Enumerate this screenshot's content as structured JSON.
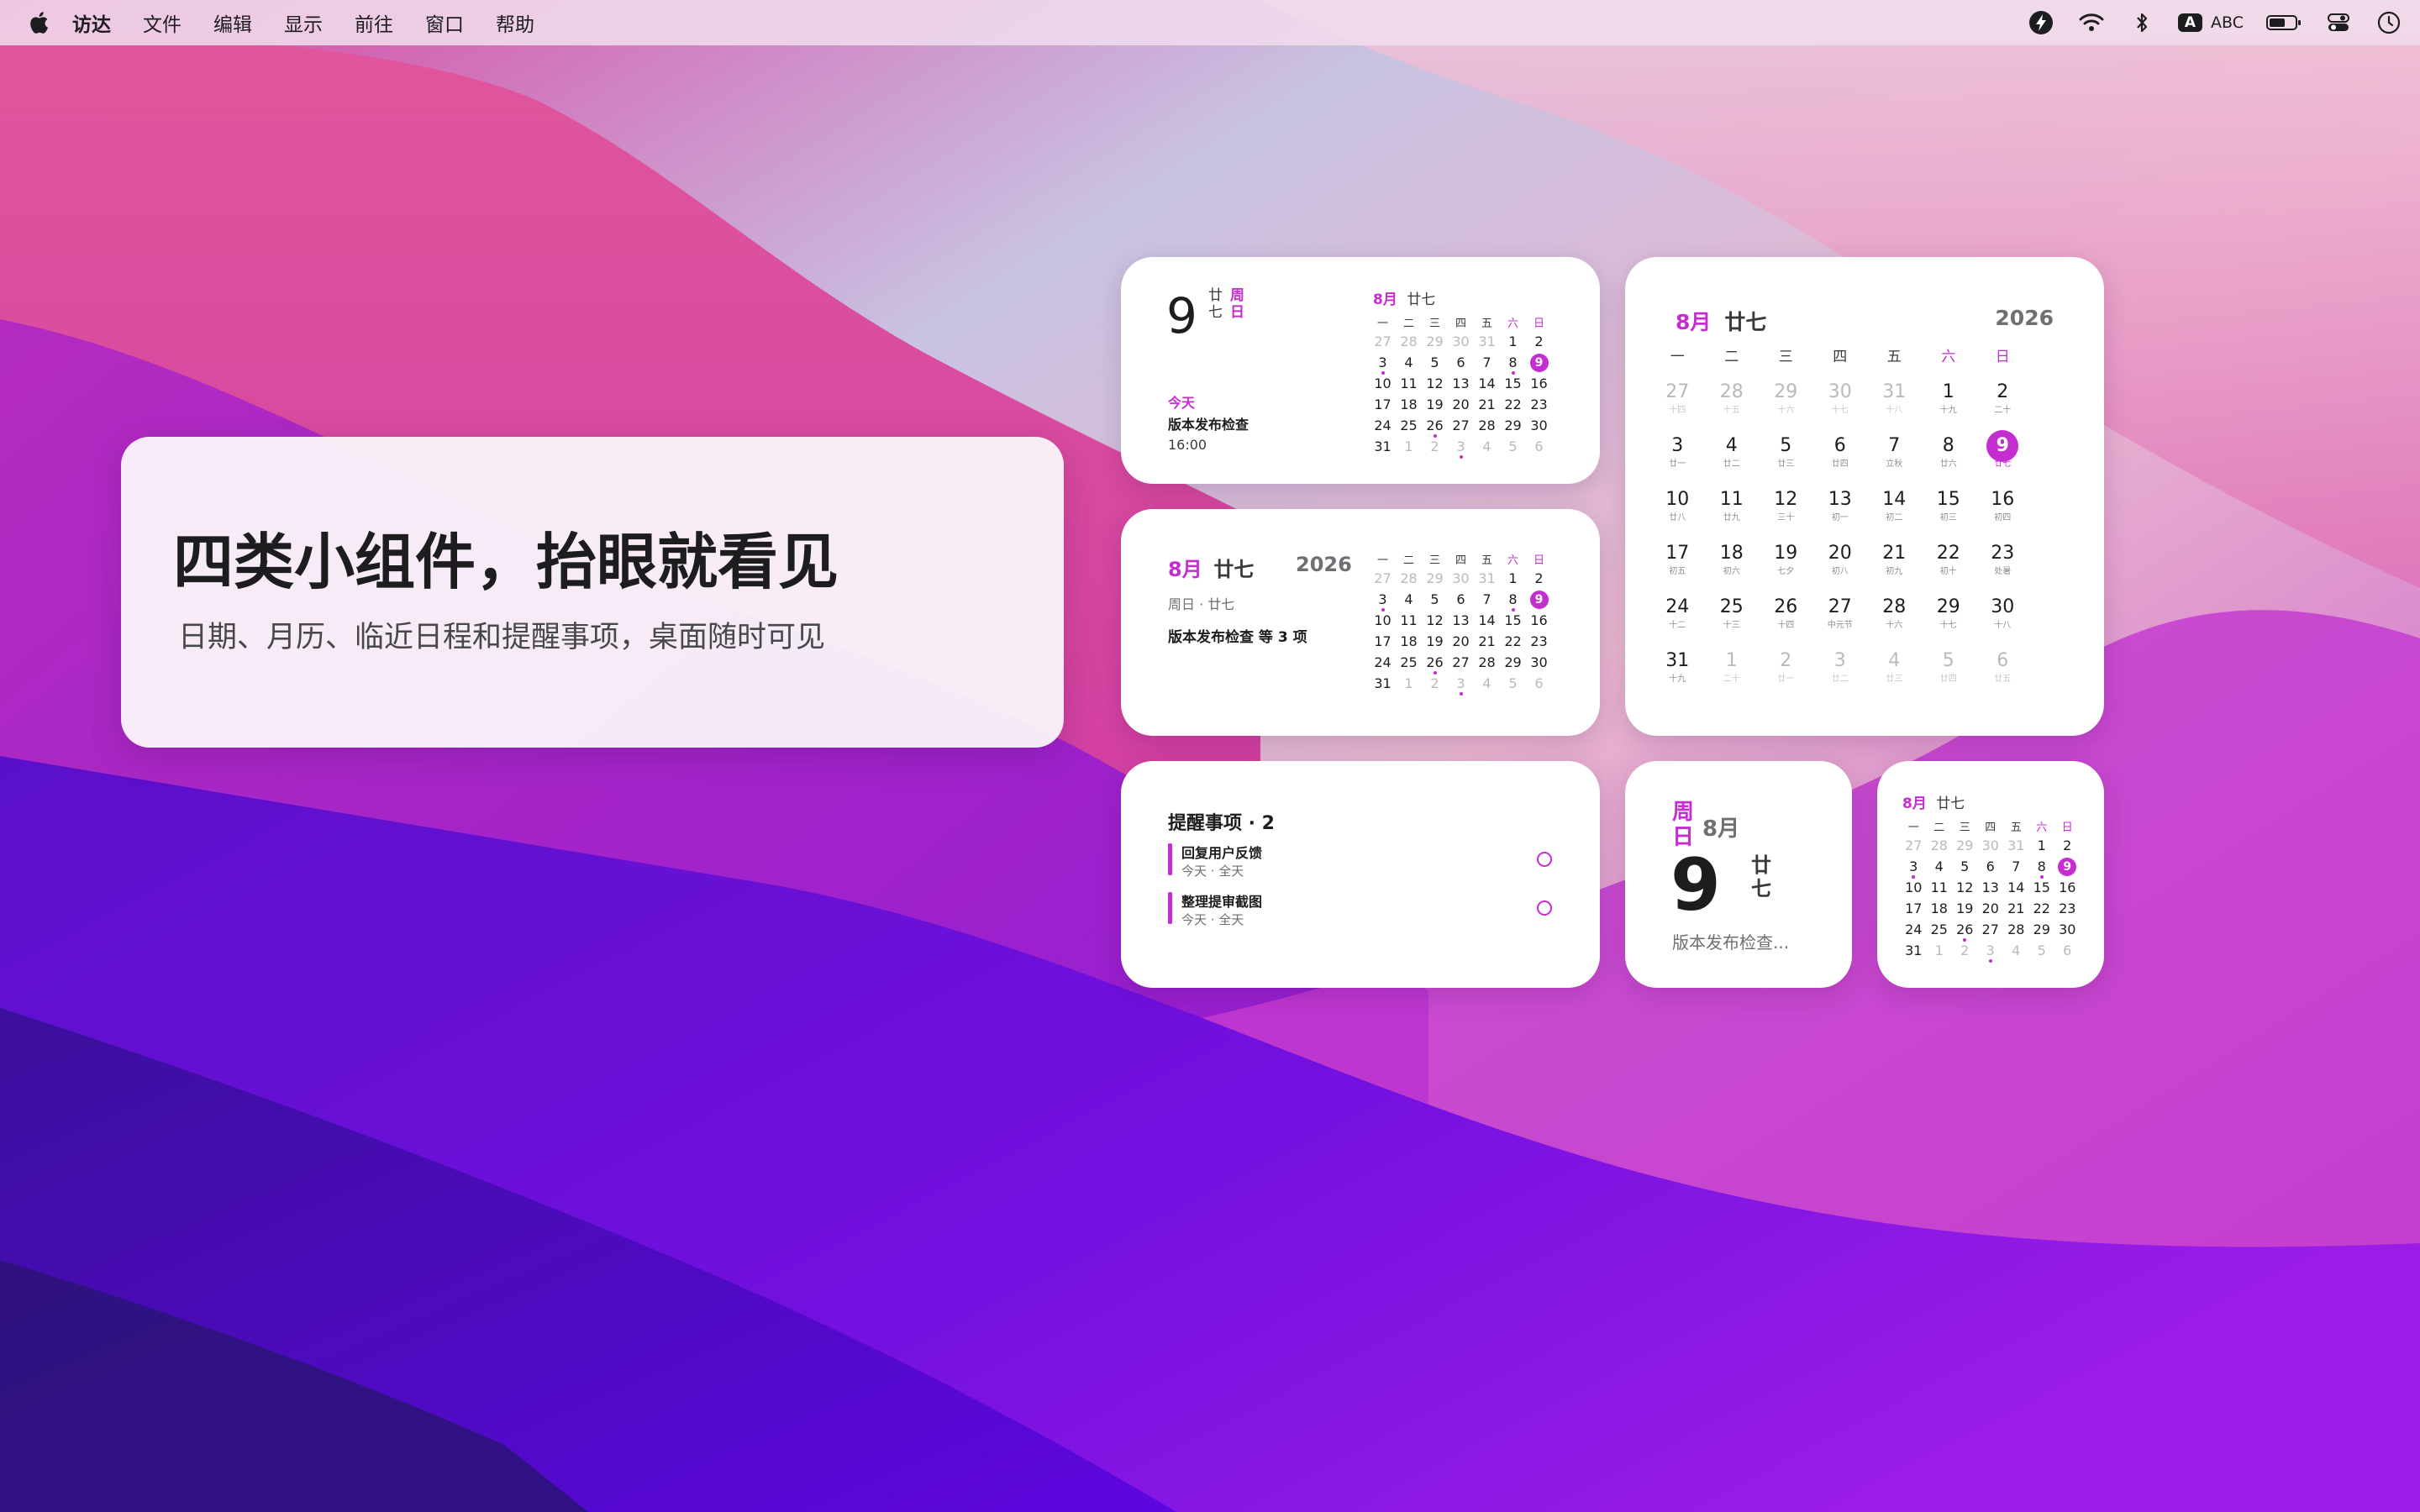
{
  "menubar": {
    "app_name": "访达",
    "items": [
      "文件",
      "编辑",
      "显示",
      "前往",
      "窗口",
      "帮助"
    ],
    "input_method": "ABC",
    "input_badge": "A"
  },
  "hero": {
    "title": "四类小组件，抬眼就看见",
    "subtitle": "日期、月历、临近日程和提醒事项，桌面随时可见"
  },
  "colors": {
    "accent": "#c52dd0",
    "card": "#ffffff"
  },
  "weekday_headers": [
    "一",
    "二",
    "三",
    "四",
    "五",
    "六",
    "日"
  ],
  "widget_today": {
    "day": "9",
    "lunar": "廿\n七",
    "weekday": "周\n日",
    "event_label": "今天",
    "event_title": "版本发布检查",
    "event_time": "16:00",
    "cal_month": "8月",
    "cal_lunar": "廿七"
  },
  "widget_month_medium": {
    "month": "8月",
    "lunar": "廿七",
    "year": "2026",
    "day_line": "周日 · 廿七",
    "summary": "版本发布检查 等 3 项"
  },
  "widget_large": {
    "month": "8月",
    "lunar": "廿七",
    "year": "2026",
    "weeks": [
      [
        [
          "27",
          "十四",
          1
        ],
        [
          "28",
          "十五",
          1
        ],
        [
          "29",
          "十六",
          1
        ],
        [
          "30",
          "十七",
          1
        ],
        [
          "31",
          "十八",
          1
        ],
        [
          "1",
          "十九",
          0
        ],
        [
          "2",
          "二十",
          0
        ]
      ],
      [
        [
          "3",
          "廿一",
          0
        ],
        [
          "4",
          "廿二",
          0
        ],
        [
          "5",
          "廿三",
          0
        ],
        [
          "6",
          "廿四",
          0
        ],
        [
          "7",
          "立秋",
          0
        ],
        [
          "8",
          "廿六",
          0
        ],
        [
          "9",
          "廿七",
          2
        ]
      ],
      [
        [
          "10",
          "廿八",
          0
        ],
        [
          "11",
          "廿九",
          0
        ],
        [
          "12",
          "三十",
          0
        ],
        [
          "13",
          "初一",
          0
        ],
        [
          "14",
          "初二",
          0
        ],
        [
          "15",
          "初三",
          0
        ],
        [
          "16",
          "初四",
          0
        ]
      ],
      [
        [
          "17",
          "初五",
          0
        ],
        [
          "18",
          "初六",
          0
        ],
        [
          "19",
          "七夕",
          0
        ],
        [
          "20",
          "初八",
          0
        ],
        [
          "21",
          "初九",
          0
        ],
        [
          "22",
          "初十",
          0
        ],
        [
          "23",
          "处暑",
          0
        ]
      ],
      [
        [
          "24",
          "十二",
          0
        ],
        [
          "25",
          "十三",
          0
        ],
        [
          "26",
          "十四",
          0
        ],
        [
          "27",
          "中元节",
          0
        ],
        [
          "28",
          "十六",
          0
        ],
        [
          "29",
          "十七",
          0
        ],
        [
          "30",
          "十八",
          0
        ]
      ],
      [
        [
          "31",
          "十九",
          0
        ],
        [
          "1",
          "二十",
          1
        ],
        [
          "2",
          "廿一",
          1
        ],
        [
          "3",
          "廿二",
          1
        ],
        [
          "4",
          "廿三",
          1
        ],
        [
          "5",
          "廿四",
          1
        ],
        [
          "6",
          "廿五",
          1
        ]
      ]
    ]
  },
  "mini_weeks": [
    [
      [
        "27",
        1
      ],
      [
        "28",
        1
      ],
      [
        "29",
        1
      ],
      [
        "30",
        1
      ],
      [
        "31",
        1
      ],
      [
        "1",
        0
      ],
      [
        "2",
        0
      ]
    ],
    [
      [
        "3",
        3
      ],
      [
        "4",
        0
      ],
      [
        "5",
        0
      ],
      [
        "6",
        0
      ],
      [
        "7",
        0
      ],
      [
        "8",
        3
      ],
      [
        "9",
        2
      ]
    ],
    [
      [
        "10",
        0
      ],
      [
        "11",
        0
      ],
      [
        "12",
        0
      ],
      [
        "13",
        0
      ],
      [
        "14",
        0
      ],
      [
        "15",
        0
      ],
      [
        "16",
        0
      ]
    ],
    [
      [
        "17",
        0
      ],
      [
        "18",
        0
      ],
      [
        "19",
        0
      ],
      [
        "20",
        0
      ],
      [
        "21",
        0
      ],
      [
        "22",
        0
      ],
      [
        "23",
        0
      ]
    ],
    [
      [
        "24",
        0
      ],
      [
        "25",
        0
      ],
      [
        "26",
        3
      ],
      [
        "27",
        0
      ],
      [
        "28",
        0
      ],
      [
        "29",
        0
      ],
      [
        "30",
        0
      ]
    ],
    [
      [
        "31",
        0
      ],
      [
        "1",
        1
      ],
      [
        "2",
        1
      ],
      [
        "3",
        4
      ],
      [
        "4",
        1
      ],
      [
        "5",
        1
      ],
      [
        "6",
        1
      ]
    ]
  ],
  "widget_reminders": {
    "title": "提醒事项 · 2",
    "items": [
      {
        "title": "回复用户反馈",
        "sub": "今天 · 全天"
      },
      {
        "title": "整理提审截图",
        "sub": "今天 · 全天"
      }
    ]
  },
  "widget_small_date": {
    "weekday": "周\n日",
    "month": "8月",
    "day": "9",
    "lunar": "廿\n七",
    "event": "版本发布检查..."
  },
  "widget_small_cal": {
    "month": "8月",
    "lunar": "廿七"
  }
}
